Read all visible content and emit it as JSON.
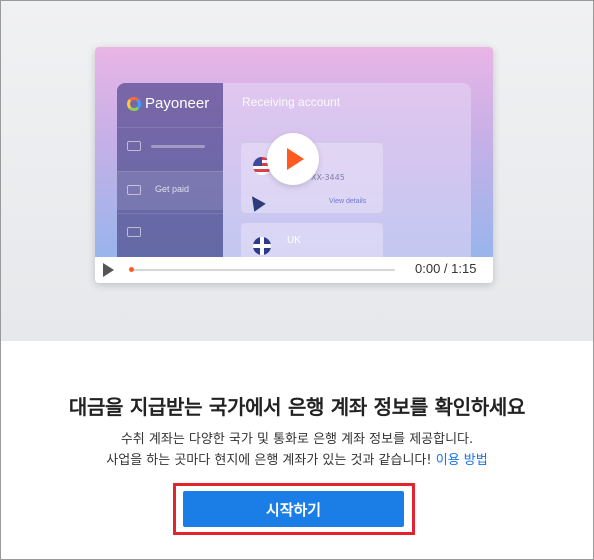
{
  "video": {
    "app_logo_text": "Payoneer",
    "panel_title": "Receiving account",
    "sidebar_item_label": "Get paid",
    "account_number": "XX-3445",
    "view_details": "View details",
    "uk_account_label": "UK",
    "time_display": "0:00 / 1:15",
    "progress": 0.0,
    "play_color": "#ff5a1f"
  },
  "content": {
    "headline": "대금을 지급받는 국가에서 은행 계좌 정보를 확인하세요",
    "description_line1": "수취 계좌는 다양한 국가 및 통화로 은행 계좌 정보를 제공합니다.",
    "description_line2": "사업을 하는 곳마다 현지에 은행 계좌가 있는 것과 같습니다!",
    "help_link": "이용 방법",
    "start_button": "시작하기",
    "button_color": "#1a7ee6",
    "highlight_color": "#e3232d"
  }
}
